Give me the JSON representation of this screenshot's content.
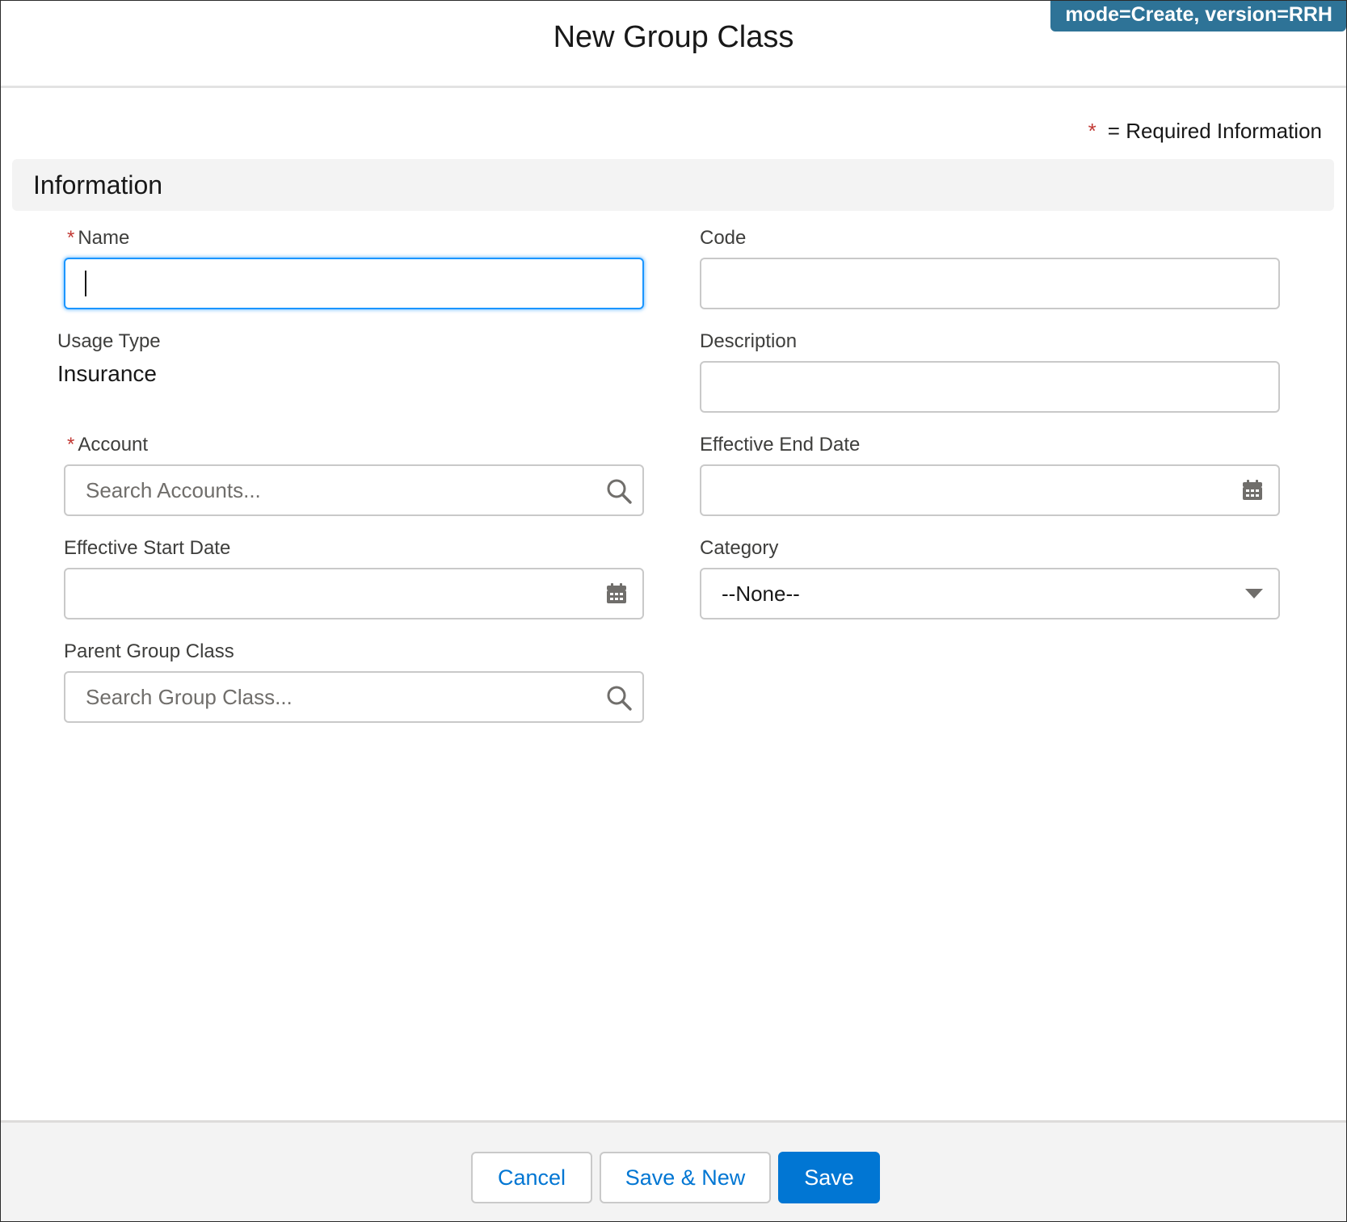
{
  "header": {
    "title": "New Group Class",
    "debug_badge": "mode=Create, version=RRH"
  },
  "legend": {
    "star": "*",
    "text": "= Required Information"
  },
  "section": {
    "title": "Information"
  },
  "fields": {
    "name": {
      "label": "Name",
      "required_mark": "*",
      "value": ""
    },
    "code": {
      "label": "Code",
      "value": ""
    },
    "usage_type": {
      "label": "Usage Type",
      "value": "Insurance"
    },
    "description": {
      "label": "Description",
      "value": ""
    },
    "account": {
      "label": "Account",
      "required_mark": "*",
      "placeholder": "Search Accounts..."
    },
    "effective_end_date": {
      "label": "Effective End Date",
      "value": ""
    },
    "effective_start_date": {
      "label": "Effective Start Date",
      "value": ""
    },
    "category": {
      "label": "Category",
      "value": "--None--"
    },
    "parent_group_class": {
      "label": "Parent Group Class",
      "placeholder": "Search Group Class..."
    }
  },
  "footer": {
    "cancel_label": "Cancel",
    "save_new_label": "Save & New",
    "save_label": "Save"
  },
  "colors": {
    "brand": "#0176d3",
    "focus": "#1b96ff",
    "required": "#c23934",
    "badge": "#2e7397"
  },
  "icons": [
    "search-icon",
    "calendar-icon",
    "chevron-down-icon"
  ]
}
